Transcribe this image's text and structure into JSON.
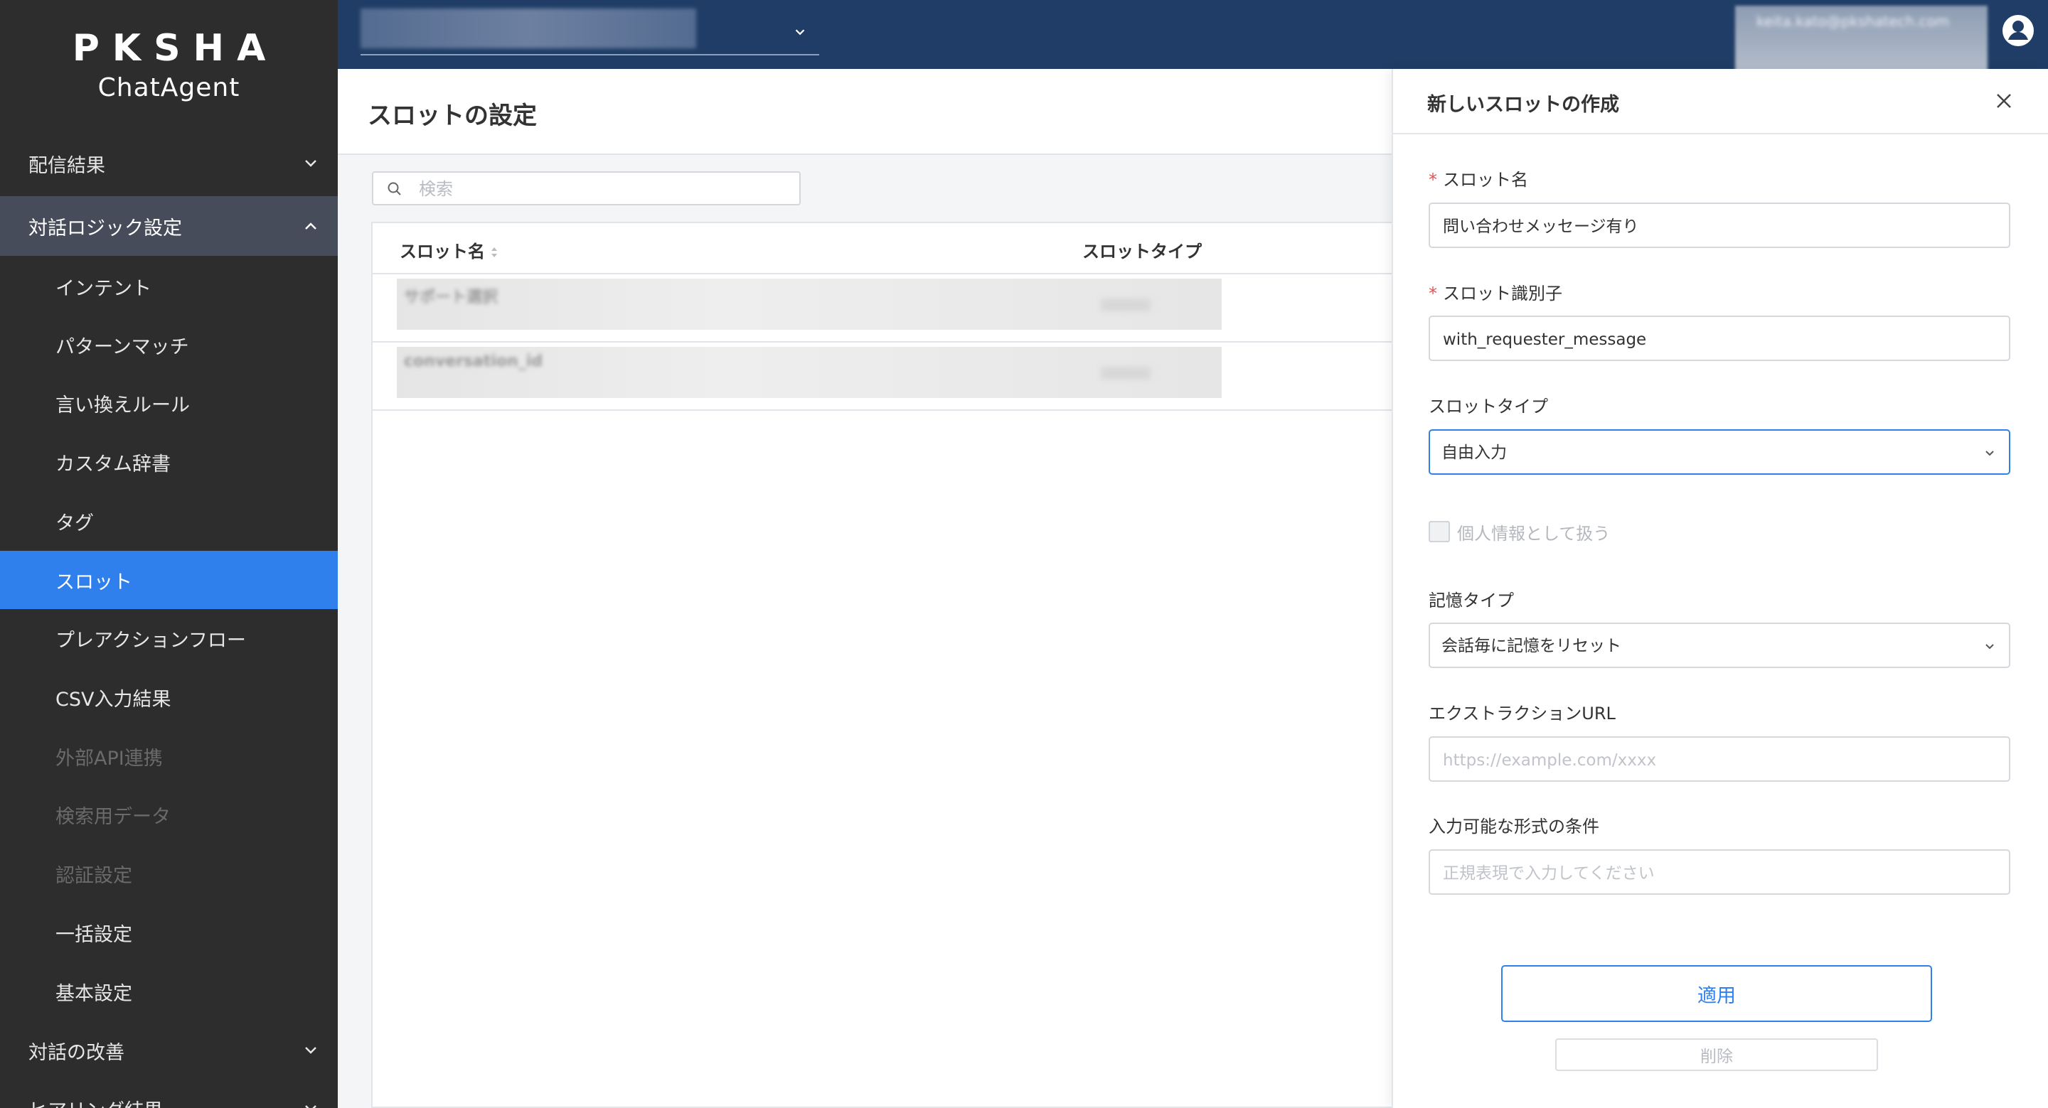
{
  "brand": {
    "logo_main": "PKSHA",
    "logo_sub": "ChatAgent"
  },
  "sidebar": {
    "sections": [
      {
        "label": "配信結果"
      },
      {
        "label": "対話ロジック設定"
      },
      {
        "label": "対話の改善"
      },
      {
        "label": "ヒアリング結果"
      }
    ],
    "items": [
      {
        "label": "インテント"
      },
      {
        "label": "パターンマッチ"
      },
      {
        "label": "言い換えルール"
      },
      {
        "label": "カスタム辞書"
      },
      {
        "label": "タグ"
      },
      {
        "label": "スロット"
      },
      {
        "label": "プレアクションフロー"
      },
      {
        "label": "CSV入力結果"
      },
      {
        "label": "外部API連携"
      },
      {
        "label": "検索用データ"
      },
      {
        "label": "認証設定"
      },
      {
        "label": "一括設定"
      },
      {
        "label": "基本設定"
      }
    ]
  },
  "topbar": {
    "user_email": "keita.kato@pkshatech.com"
  },
  "main": {
    "title": "スロットの設定",
    "search_placeholder": "検索",
    "table": {
      "col_name": "スロット名",
      "col_type": "スロットタイプ",
      "rows": [
        {
          "name": "サポート選択"
        },
        {
          "name": "conversation_id"
        }
      ]
    }
  },
  "drawer": {
    "title": "新しいスロットの作成",
    "required_mark": "*",
    "slot_name_label": "スロット名",
    "slot_name_value": "問い合わせメッセージ有り",
    "slot_id_label": "スロット識別子",
    "slot_id_value": "with_requester_message",
    "slot_type_label": "スロットタイプ",
    "slot_type_value": "自由入力",
    "personal_info_label": "個人情報として扱う",
    "memory_type_label": "記憶タイプ",
    "memory_type_value": "会話毎に記憶をリセット",
    "extraction_url_label": "エクストラクションURL",
    "extraction_url_placeholder": "https://example.com/xxxx",
    "format_label": "入力可能な形式の条件",
    "format_placeholder": "正規表現で入力してください",
    "apply_label": "適用",
    "delete_label": "削除"
  },
  "colors": {
    "sidebar_bg": "#2d2d2d",
    "sidebar_open_section": "#464c59",
    "active_item": "#2f80ed",
    "topbar_bg": "#1f3d66",
    "required": "#e05151"
  }
}
